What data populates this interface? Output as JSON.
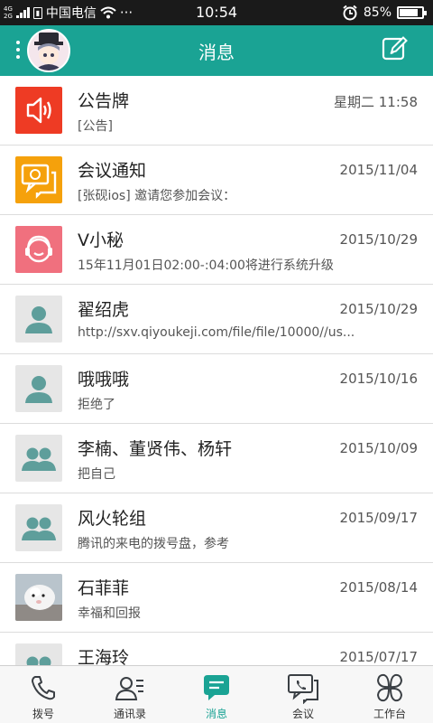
{
  "status": {
    "net_top": "4G",
    "net_bottom": "2G",
    "carrier": "中国电信",
    "more": "···",
    "time": "10:54",
    "battery": "85%",
    "battery_level": 0.85
  },
  "header": {
    "title": "消息"
  },
  "messages": [
    {
      "name": "公告牌",
      "preview": "[公告]",
      "date": "星期二 11:58",
      "icon": "speaker-icon",
      "color": "#ee3b24"
    },
    {
      "name": "会议通知",
      "preview": "[张砚ios] 邀请您参加会议：",
      "date": "2015/11/04",
      "icon": "meeting-icon",
      "color": "#f5a10b"
    },
    {
      "name": "V小秘",
      "preview": "15年11月01日02:00-:04:00将进行系统升级",
      "date": "2015/10/29",
      "icon": "headset-icon",
      "color": "#f0707e"
    },
    {
      "name": "翟绍虎",
      "preview": "http://sxv.qiyoukeji.com/file/file/10000//us...",
      "date": "2015/10/29",
      "icon": "person-icon",
      "color": "#e6e6e6"
    },
    {
      "name": "哦哦哦",
      "preview": "拒绝了",
      "date": "2015/10/16",
      "icon": "person-icon",
      "color": "#e6e6e6"
    },
    {
      "name": "李楠、董贤伟、杨轩",
      "preview": "把自己",
      "date": "2015/10/09",
      "icon": "group-icon",
      "color": "#e6e6e6"
    },
    {
      "name": "风火轮组",
      "preview": "腾讯的来电的拨号盘，参考",
      "date": "2015/09/17",
      "icon": "group-icon",
      "color": "#e6e6e6"
    },
    {
      "name": "石菲菲",
      "preview": "幸福和回报",
      "date": "2015/08/14",
      "icon": "photo-avatar",
      "color": "#cfd6dc"
    },
    {
      "name": "王海玲",
      "preview": "",
      "date": "2015/07/17",
      "icon": "group-icon",
      "color": "#e6e6e6"
    }
  ],
  "tabs": [
    {
      "label": "拨号",
      "icon": "phone-icon"
    },
    {
      "label": "通讯录",
      "icon": "contacts-icon"
    },
    {
      "label": "消息",
      "icon": "message-icon",
      "active": true
    },
    {
      "label": "会议",
      "icon": "meeting-icon"
    },
    {
      "label": "工作台",
      "icon": "workbench-icon"
    }
  ],
  "colors": {
    "accent": "#1aa394",
    "tab_icon": "#3a3f44"
  }
}
